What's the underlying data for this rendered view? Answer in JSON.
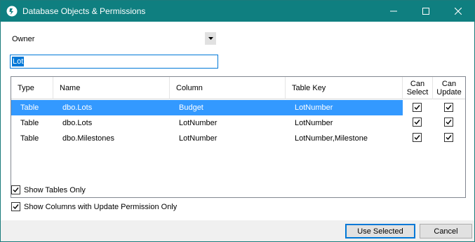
{
  "window": {
    "title": "Database Objects & Permissions",
    "accent": "#0f7f80",
    "controls": {
      "minimize": "minimize-icon",
      "maximize": "maximize-icon",
      "close": "close-icon"
    }
  },
  "owner": {
    "selected": "Owner"
  },
  "filter": {
    "value": "Lot"
  },
  "grid": {
    "headers": {
      "type": "Type",
      "name": "Name",
      "column": "Column",
      "table_key": "Table Key",
      "can_select_1": "Can",
      "can_select_2": "Select",
      "can_update_1": "Can",
      "can_update_2": "Update"
    },
    "selection_color": "#3399ff",
    "rows": [
      {
        "type": "Table",
        "name": "dbo.Lots",
        "column": "Budget",
        "table_key": "LotNumber",
        "can_select": true,
        "can_update": true,
        "selected": true
      },
      {
        "type": "Table",
        "name": "dbo.Lots",
        "column": "LotNumber",
        "table_key": "LotNumber",
        "can_select": true,
        "can_update": true,
        "selected": false
      },
      {
        "type": "Table",
        "name": "dbo.Milestones",
        "column": "LotNumber",
        "table_key": "LotNumber,Milestone",
        "can_select": true,
        "can_update": true,
        "selected": false
      }
    ]
  },
  "options": {
    "show_tables_only": {
      "label": "Show Tables Only",
      "checked": true
    },
    "show_update_only": {
      "label": "Show Columns with Update Permission Only",
      "checked": true
    }
  },
  "buttons": {
    "use_selected": "Use Selected",
    "cancel": "Cancel"
  }
}
